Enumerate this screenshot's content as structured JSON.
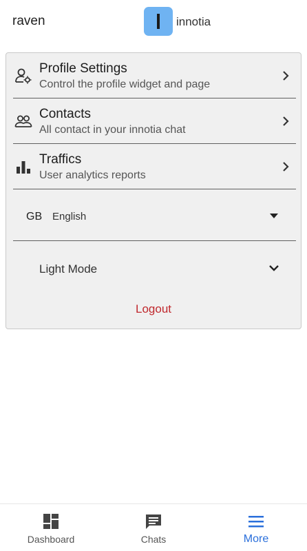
{
  "header": {
    "username": "raven",
    "brand": "innotia"
  },
  "menu": {
    "items": [
      {
        "title": "Profile Settings",
        "subtitle": "Control the profile widget and page",
        "icon": "profile-settings-icon"
      },
      {
        "title": "Contacts",
        "subtitle": "All contact in your innotia chat",
        "icon": "contacts-icon"
      },
      {
        "title": "Traffics",
        "subtitle": "User analytics reports",
        "icon": "bar-chart-icon"
      }
    ],
    "language": {
      "code": "GB",
      "name": "English"
    },
    "theme": {
      "label": "Light Mode"
    },
    "logout_label": "Logout"
  },
  "bottom_nav": {
    "items": [
      {
        "label": "Dashboard",
        "icon": "dashboard-icon"
      },
      {
        "label": "Chats",
        "icon": "chat-icon"
      },
      {
        "label": "More",
        "icon": "menu-icon",
        "active": true
      }
    ]
  },
  "colors": {
    "brand": "#6fb3f2",
    "active": "#2a6fdb",
    "logout": "#c0282d"
  }
}
